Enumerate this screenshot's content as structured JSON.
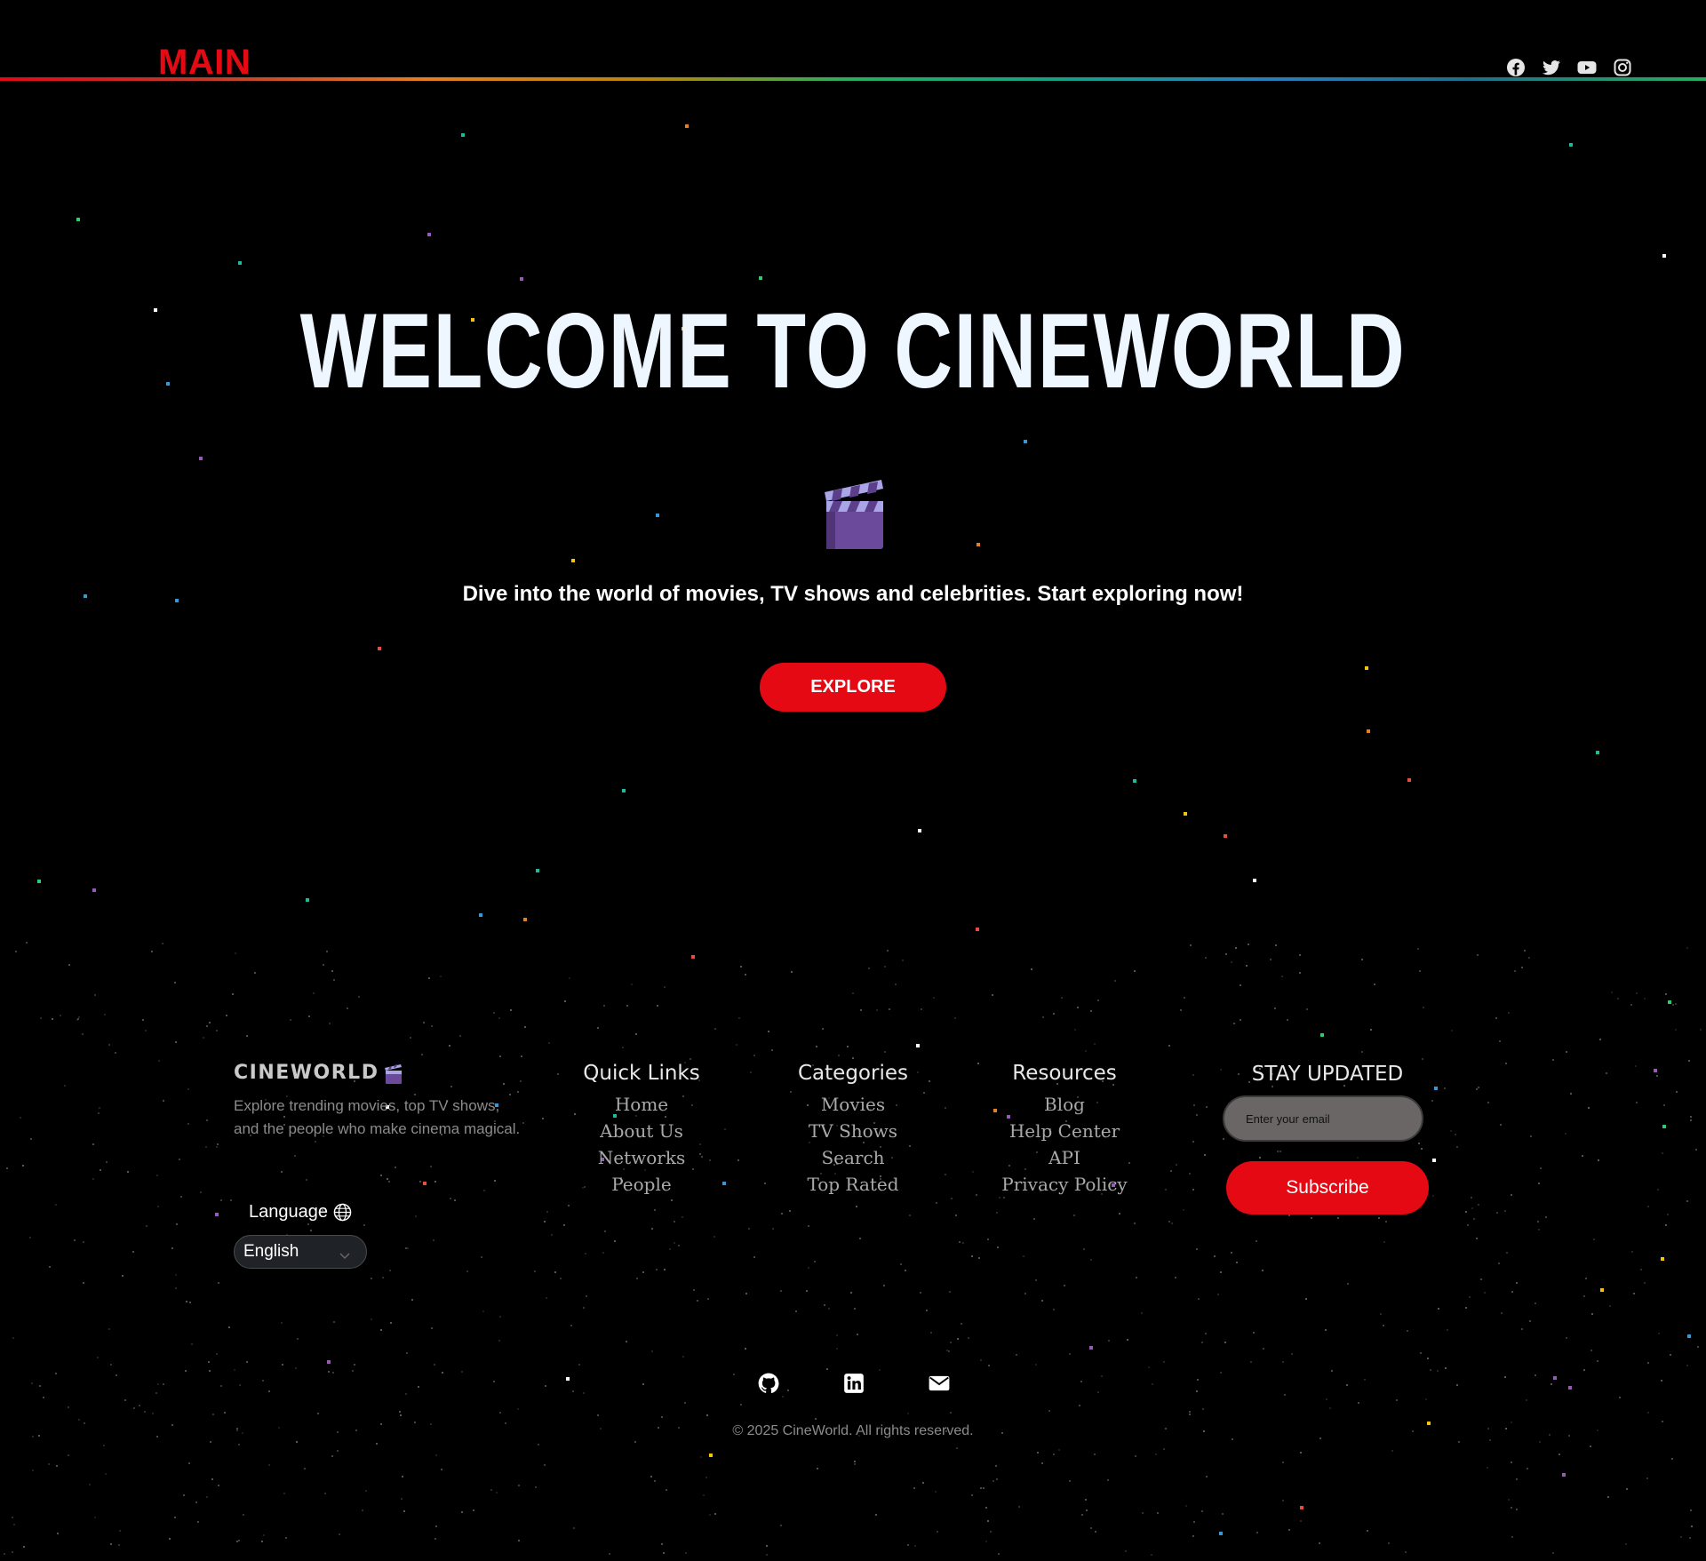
{
  "header": {
    "logo": "MAIN",
    "social_icons": [
      "facebook-icon",
      "twitter-icon",
      "youtube-icon",
      "instagram-icon"
    ]
  },
  "hero": {
    "title": "WELCOME TO CINEWORLD",
    "icon": "clapperboard-icon",
    "subtitle": "Dive into the world of movies, TV shows and celebrities. Start exploring now!",
    "explore_label": "EXPLORE"
  },
  "footer": {
    "brand": "CINEWORLD",
    "brand_icon": "clapperboard-icon",
    "description": "Explore trending movies, top TV shows, and the people who make cinema magical.",
    "language_label": "Language",
    "language_value": "English",
    "columns": [
      {
        "title": "Quick Links",
        "links": [
          "Home",
          "About Us",
          "Networks",
          "People"
        ]
      },
      {
        "title": "Categories",
        "links": [
          "Movies",
          "TV Shows",
          "Search",
          "Top Rated"
        ]
      },
      {
        "title": "Resources",
        "links": [
          "Blog",
          "Help Center",
          "API",
          "Privacy Policy"
        ]
      }
    ],
    "newsletter": {
      "title": "STAY UPDATED",
      "email_placeholder": "Enter your email",
      "subscribe_label": "Subscribe"
    },
    "contact_icons": [
      "github-icon",
      "linkedin-icon",
      "email-icon"
    ],
    "copyright": "© 2025 CineWorld. All rights reserved."
  },
  "colors": {
    "background": "#000000",
    "accent": "#e50914",
    "title": "#eef6ff",
    "muted_text": "#8b8b8b",
    "link_text": "#a9a9a9"
  }
}
